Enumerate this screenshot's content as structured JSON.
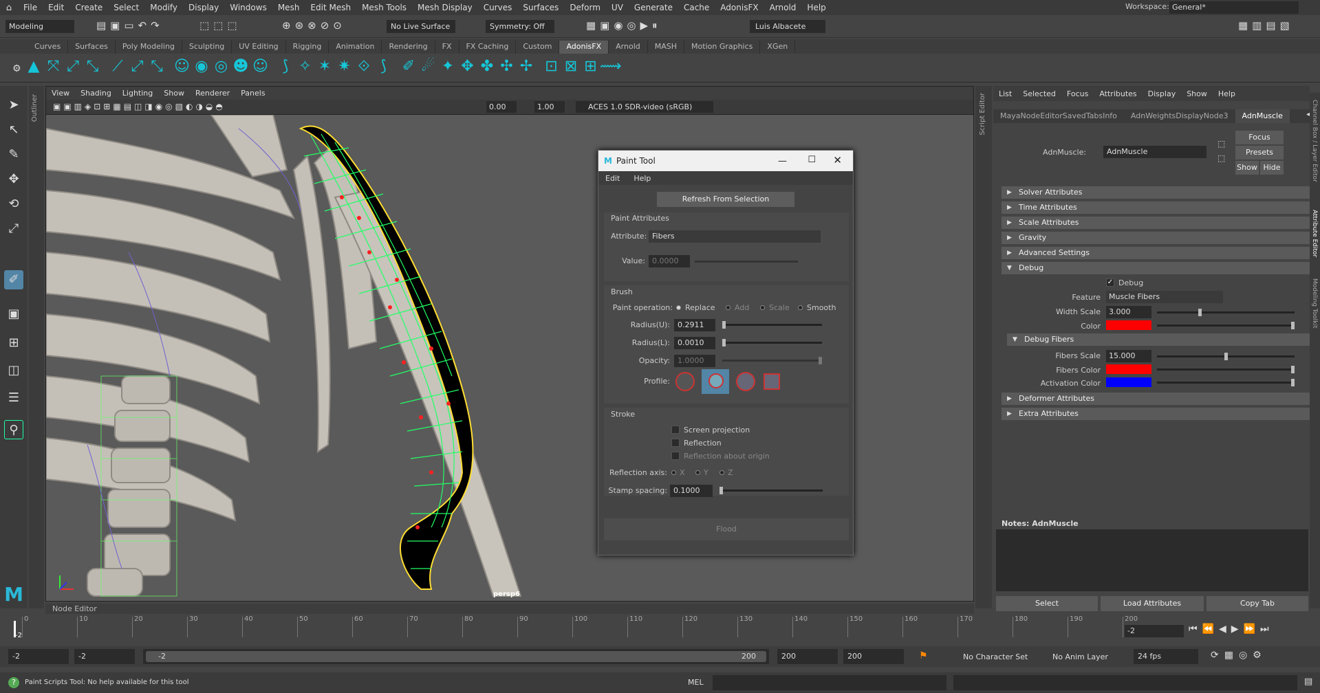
{
  "menubar": {
    "items": [
      "File",
      "Edit",
      "Create",
      "Select",
      "Modify",
      "Display",
      "Windows",
      "Mesh",
      "Edit Mesh",
      "Mesh Tools",
      "Mesh Display",
      "Curves",
      "Surfaces",
      "Deform",
      "UV",
      "Generate",
      "Cache",
      "AdonisFX",
      "Arnold",
      "Help"
    ],
    "workspace_label": "Workspace:",
    "workspace_value": "General*"
  },
  "status": {
    "mode": "Modeling",
    "live_surface": "No Live Surface",
    "symmetry": "Symmetry: Off",
    "user": "Luis Albacete"
  },
  "shelf_tabs": [
    "Curves",
    "Surfaces",
    "Poly Modeling",
    "Sculpting",
    "UV Editing",
    "Rigging",
    "Animation",
    "Rendering",
    "FX",
    "FX Caching",
    "Custom",
    "AdonisFX",
    "Arnold",
    "MASH",
    "Motion Graphics",
    "XGen"
  ],
  "shelf_active": "AdonisFX",
  "viewport": {
    "menus": [
      "View",
      "Shading",
      "Lighting",
      "Show",
      "Renderer",
      "Panels"
    ],
    "exposure": "0.00",
    "gamma": "1.00",
    "colorspace": "ACES 1.0 SDR-video (sRGB)",
    "camera": "persp6"
  },
  "side_labels": {
    "outliner": "Outliner",
    "script_editor": "Script Editor",
    "channel_box": "Channel Box / Layer Editor",
    "attribute_editor": "Attribute Editor",
    "modeling_toolkit": "Modeling Toolkit"
  },
  "paint_tool": {
    "title": "Paint Tool",
    "menus": [
      "Edit",
      "Help"
    ],
    "refresh_button": "Refresh From Selection",
    "paint_attributes": "Paint Attributes",
    "attribute_label": "Attribute:",
    "attribute_value": "Fibers",
    "value_label": "Value:",
    "value_value": "0.0000",
    "brush": "Brush",
    "paint_operation": "Paint operation:",
    "operations": [
      "Replace",
      "Add",
      "Scale",
      "Smooth"
    ],
    "radius_u_label": "Radius(U):",
    "radius_u": "0.2911",
    "radius_l_label": "Radius(L):",
    "radius_l": "0.0010",
    "opacity_label": "Opacity:",
    "opacity": "1.0000",
    "profile_label": "Profile:",
    "stroke": "Stroke",
    "screen_projection": "Screen projection",
    "reflection": "Reflection",
    "reflection_origin": "Reflection about origin",
    "reflection_axis": "Reflection axis:",
    "axes": [
      "X",
      "Y",
      "Z"
    ],
    "stamp_spacing_label": "Stamp spacing:",
    "stamp_spacing": "0.1000",
    "flood": "Flood"
  },
  "attr_editor": {
    "menus": [
      "List",
      "Selected",
      "Focus",
      "Attributes",
      "Display",
      "Show",
      "Help"
    ],
    "tabs": [
      "MayaNodeEditorSavedTabsInfo",
      "AdnWeightsDisplayNode3",
      "AdnMuscle"
    ],
    "node_label": "AdnMuscle:",
    "node_value": "AdnMuscle",
    "focus": "Focus",
    "presets": "Presets",
    "show": "Show",
    "hide": "Hide",
    "sections": [
      "Solver Attributes",
      "Time Attributes",
      "Scale Attributes",
      "Gravity",
      "Advanced Settings",
      "Debug"
    ],
    "debug_check": "Debug",
    "feature_label": "Feature",
    "feature_value": "Muscle Fibers",
    "width_scale_label": "Width Scale",
    "width_scale": "3.000",
    "color_label": "Color",
    "debug_fibers": "Debug Fibers",
    "fibers_scale_label": "Fibers Scale",
    "fibers_scale": "15.000",
    "fibers_color_label": "Fibers Color",
    "activation_color_label": "Activation Color",
    "more_sections": [
      "Deformer Attributes",
      "Extra Attributes"
    ],
    "notes": "Notes:  AdnMuscle",
    "select": "Select",
    "load": "Load Attributes",
    "copy": "Copy Tab",
    "colors": {
      "color": "#ff0000",
      "fibers": "#ff0000",
      "activation": "#0000ff"
    }
  },
  "node_editor": "Node Editor",
  "timeline": {
    "ticks": [
      "0",
      "10",
      "20",
      "30",
      "40",
      "50",
      "60",
      "70",
      "80",
      "90",
      "100",
      "110",
      "120",
      "130",
      "140",
      "150",
      "160",
      "170",
      "180",
      "190",
      "200"
    ],
    "current": "-2",
    "current_field": "-2"
  },
  "range": {
    "start": "-2",
    "start2": "-2",
    "slider_start": "-2",
    "slider_end": "200",
    "end": "200",
    "end2": "200",
    "character": "No Character Set",
    "anim_layer": "No Anim Layer",
    "fps": "24 fps"
  },
  "help": {
    "text": "Paint Scripts Tool: No help available for this tool",
    "mel": "MEL"
  }
}
